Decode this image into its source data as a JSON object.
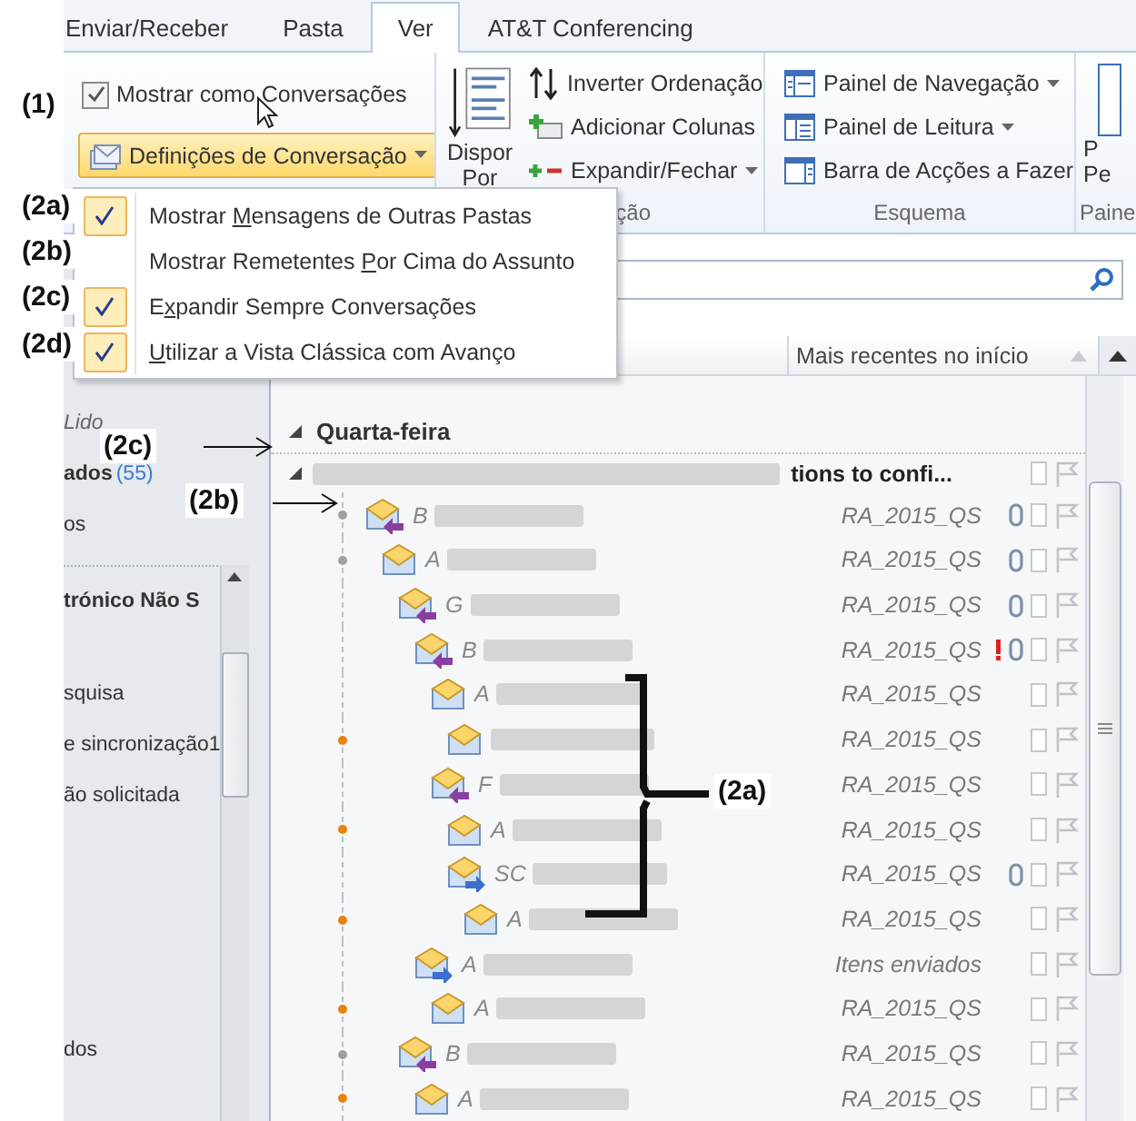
{
  "annotations": {
    "gutter": [
      {
        "text": "(1)"
      },
      {
        "text": "(2a)"
      },
      {
        "text": "(2b)"
      },
      {
        "text": "(2c)"
      },
      {
        "text": "(2d)"
      }
    ],
    "callouts": [
      {
        "text": "(2c)",
        "kind": "arrow"
      },
      {
        "text": "(2b)",
        "kind": "arrow"
      },
      {
        "text": "(2a)",
        "kind": "brace"
      }
    ]
  },
  "tabs": [
    {
      "label": "Enviar/Receber",
      "selected": false
    },
    {
      "label": "Pasta",
      "selected": false
    },
    {
      "label": "Ver",
      "selected": true
    },
    {
      "label": "AT&T Conferencing",
      "selected": false
    }
  ],
  "ribbon": {
    "conversations_group": {
      "show_as_conversations": {
        "label": "Mostrar como Conversações",
        "checked": true
      },
      "settings_button": {
        "label": "Definições de Conversação"
      }
    },
    "arrangement_group": {
      "label": "ção",
      "arrange_by": {
        "line1": "Dispor",
        "line2": "Por"
      },
      "buttons": [
        {
          "label": "Inverter Ordenação",
          "kind": "reverse",
          "has_menu": false
        },
        {
          "label": "Adicionar Colunas",
          "kind": "add",
          "has_menu": false
        },
        {
          "label": "Expandir/Fechar",
          "kind": "expand",
          "has_menu": true
        }
      ]
    },
    "layout_group": {
      "label": "Esquema",
      "buttons": [
        {
          "label": "Painel de Navegação",
          "kind": "nav"
        },
        {
          "label": "Painel de Leitura",
          "kind": "reading"
        },
        {
          "label": "Barra de Acções a Fazer",
          "kind": "todo"
        }
      ]
    },
    "people_group": {
      "label": "Paine",
      "line1": "P",
      "line2": "Pe"
    }
  },
  "conversation_menu": [
    {
      "before": "Mostrar ",
      "key": "M",
      "after": "ensagens de Outras Pastas",
      "checked": true
    },
    {
      "before": "Mostrar Remetentes ",
      "key": "P",
      "after": "or Cima do Assunto",
      "checked": false
    },
    {
      "before": "E",
      "key": "x",
      "after": "pandir Sempre Conversações",
      "checked": true
    },
    {
      "key": "U",
      "after": "tilizar a Vista Clássica com Avanço",
      "checked": true
    }
  ],
  "folder_pane": {
    "sections": [
      {
        "items": [
          {
            "label": "Lido",
            "kind": "italic"
          },
          {
            "label": "ados",
            "count": "(55)",
            "kind": "bold"
          },
          {
            "label": "os",
            "kind": "plain"
          }
        ]
      },
      {
        "heading": "trónico Não S",
        "items": [
          {
            "label": "squisa",
            "kind": "plain"
          },
          {
            "label": "e sincronização1",
            "kind": "plain"
          },
          {
            "label": "ão solicitada",
            "kind": "plain"
          }
        ]
      },
      {
        "items": [
          {
            "label": "dos",
            "kind": "plain"
          }
        ]
      }
    ]
  },
  "message_list": {
    "sort_label": "Mais recentes no início",
    "group": {
      "label": "Quarta-feira",
      "expanded": true
    },
    "conversation": {
      "subject": "tions to confi...",
      "expanded": true,
      "messages": [
        {
          "initial": "B",
          "kind": "replied",
          "folder": "RA_2015_QS",
          "attachment": true,
          "important": false,
          "color": "#a0a0a0",
          "children": [
            {
              "initial": "A",
              "kind": "read",
              "folder": "RA_2015_QS",
              "attachment": true,
              "important": false,
              "color": "#a0a0a0",
              "children": [
                {
                  "initial": "G",
                  "kind": "replied",
                  "folder": "RA_2015_QS",
                  "attachment": true,
                  "important": false,
                  "children": [
                    {
                      "initial": "B",
                      "kind": "replied",
                      "folder": "RA_2015_QS",
                      "attachment": true,
                      "important": true,
                      "children": [
                        {
                          "initial": "A",
                          "kind": "read",
                          "folder": "RA_2015_QS",
                          "attachment": false,
                          "important": false,
                          "children": [
                            {
                              "kind": "read",
                              "folder": "RA_2015_QS",
                              "attachment": false,
                              "important": false,
                              "color": "#e8820c"
                            }
                          ]
                        },
                        {
                          "initial": "F",
                          "kind": "replied",
                          "folder": "RA_2015_QS",
                          "attachment": false,
                          "important": false,
                          "children": [
                            {
                              "initial": "A",
                              "kind": "read",
                              "folder": "RA_2015_QS",
                              "attachment": false,
                              "important": false,
                              "color": "#e8820c"
                            },
                            {
                              "initial": "SC",
                              "kind": "forwarded",
                              "folder": "RA_2015_QS",
                              "attachment": true,
                              "important": false,
                              "children": [
                                {
                                  "initial": "A",
                                  "kind": "read",
                                  "folder": "RA_2015_QS",
                                  "attachment": false,
                                  "important": false,
                                  "color": "#e8820c"
                                }
                              ]
                            }
                          ]
                        }
                      ]
                    },
                    {
                      "initial": "A",
                      "kind": "forwarded",
                      "folder": "Itens enviados",
                      "attachment": false,
                      "important": false,
                      "children": [
                        {
                          "initial": "A",
                          "kind": "read",
                          "folder": "RA_2015_QS",
                          "attachment": false,
                          "important": false,
                          "color": "#e8820c"
                        }
                      ]
                    }
                  ]
                },
                {
                  "initial": "B",
                  "kind": "replied",
                  "folder": "RA_2015_QS",
                  "attachment": false,
                  "important": false,
                  "color": "#a0a0a0",
                  "children": [
                    {
                      "initial": "A",
                      "kind": "read",
                      "folder": "RA_2015_QS",
                      "attachment": false,
                      "important": false,
                      "color": "#e8820c"
                    }
                  ]
                }
              ]
            }
          ]
        }
      ]
    }
  }
}
